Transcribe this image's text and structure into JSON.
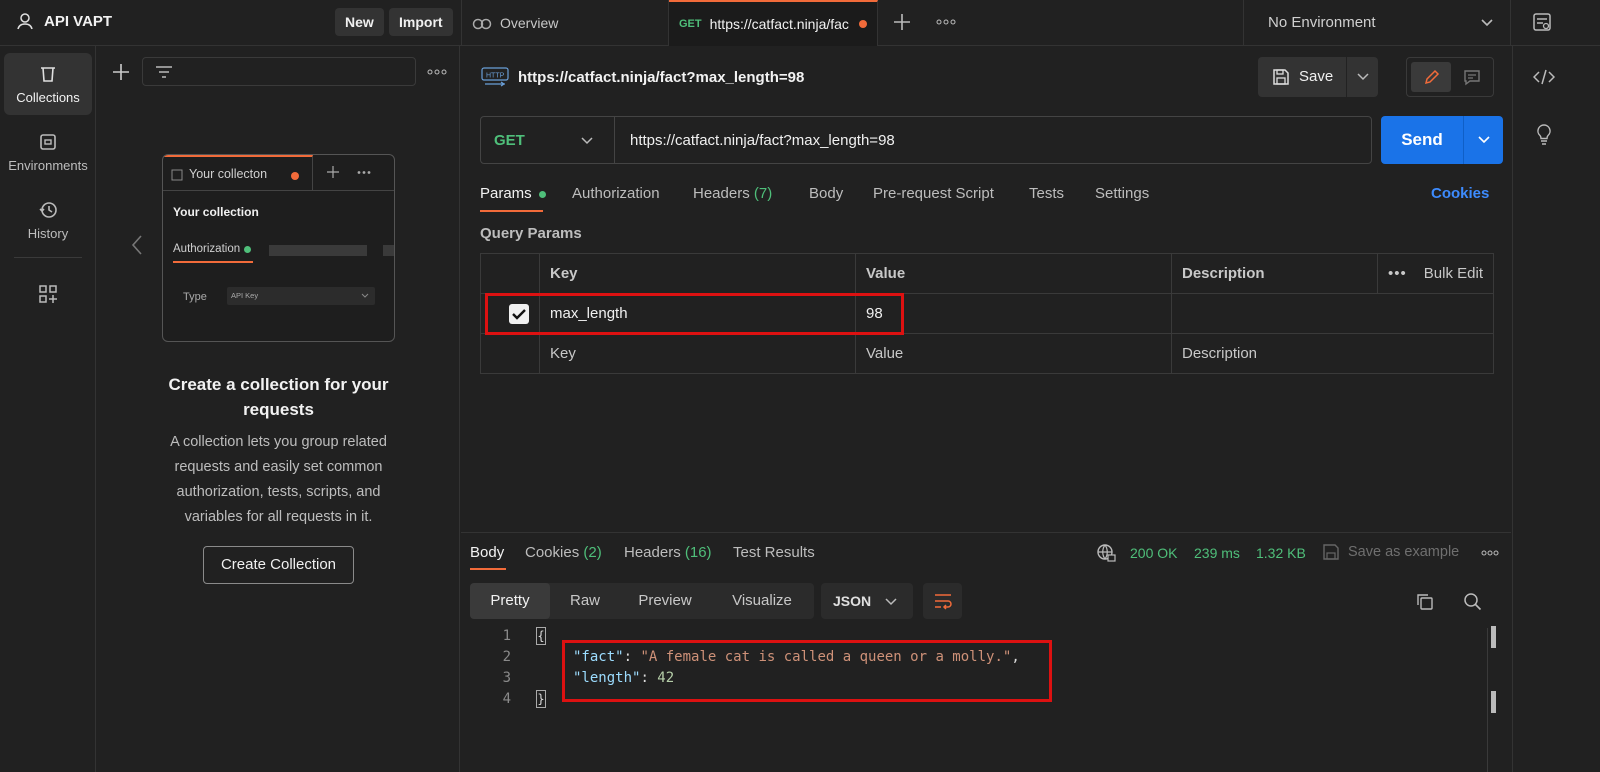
{
  "workspace": {
    "title": "API VAPT",
    "new_label": "New",
    "import_label": "Import"
  },
  "tabs": [
    {
      "label": "Overview",
      "icon": "overview-icon"
    },
    {
      "method": "GET",
      "label": "https://catfact.ninja/fac",
      "unsaved": true
    }
  ],
  "environment": {
    "selected": "No Environment"
  },
  "rail": [
    {
      "label": "Collections",
      "icon": "trash-collection-icon",
      "active": true
    },
    {
      "label": "Environments",
      "icon": "environment-icon"
    },
    {
      "label": "History",
      "icon": "history-icon"
    },
    {
      "label": "",
      "icon": "add-widget-icon"
    }
  ],
  "illustration": {
    "tab_label": "Your collecton",
    "heading": "Your collection",
    "auth_tab": "Authorization",
    "type_label": "Type",
    "type_value": "API Key"
  },
  "empty_state": {
    "title": "Create a collection for your requests",
    "text": "A collection lets you group related requests and easily set common authorization, tests, scripts, and variables for all requests in it.",
    "button": "Create Collection"
  },
  "request": {
    "name": "https://catfact.ninja/fact?max_length=98",
    "save_label": "Save",
    "method": "GET",
    "url": "https://catfact.ninja/fact?max_length=98",
    "send_label": "Send",
    "tabs": [
      "Params",
      "Authorization",
      "Headers",
      "Body",
      "Pre-request Script",
      "Tests",
      "Settings"
    ],
    "headers_count": "(7)",
    "cookies_label": "Cookies",
    "query_params_label": "Query Params",
    "columns": {
      "key": "Key",
      "value": "Value",
      "description": "Description",
      "bulk_edit": "Bulk Edit"
    },
    "params": [
      {
        "key": "max_length",
        "value": "98",
        "enabled": true
      }
    ],
    "placeholders": {
      "key": "Key",
      "value": "Value",
      "description": "Description"
    }
  },
  "response": {
    "tabs": [
      "Body",
      "Cookies",
      "Headers",
      "Test Results"
    ],
    "cookies_count": "(2)",
    "headers_count": "(16)",
    "status": "200 OK",
    "time": "239 ms",
    "size": "1.32 KB",
    "save_example": "Save as example",
    "views": [
      "Pretty",
      "Raw",
      "Preview",
      "Visualize"
    ],
    "format": "JSON",
    "lines": [
      "1",
      "2",
      "3",
      "4"
    ],
    "json": {
      "fact_key": "\"fact\"",
      "fact_value": "\"A female cat is called a queen or a molly.\"",
      "length_key": "\"length\"",
      "length_value": "42"
    }
  },
  "colors": {
    "accent": "#f26b3a",
    "send": "#1a73e8",
    "success": "#4fbf7a",
    "highlight": "#dd1111"
  }
}
